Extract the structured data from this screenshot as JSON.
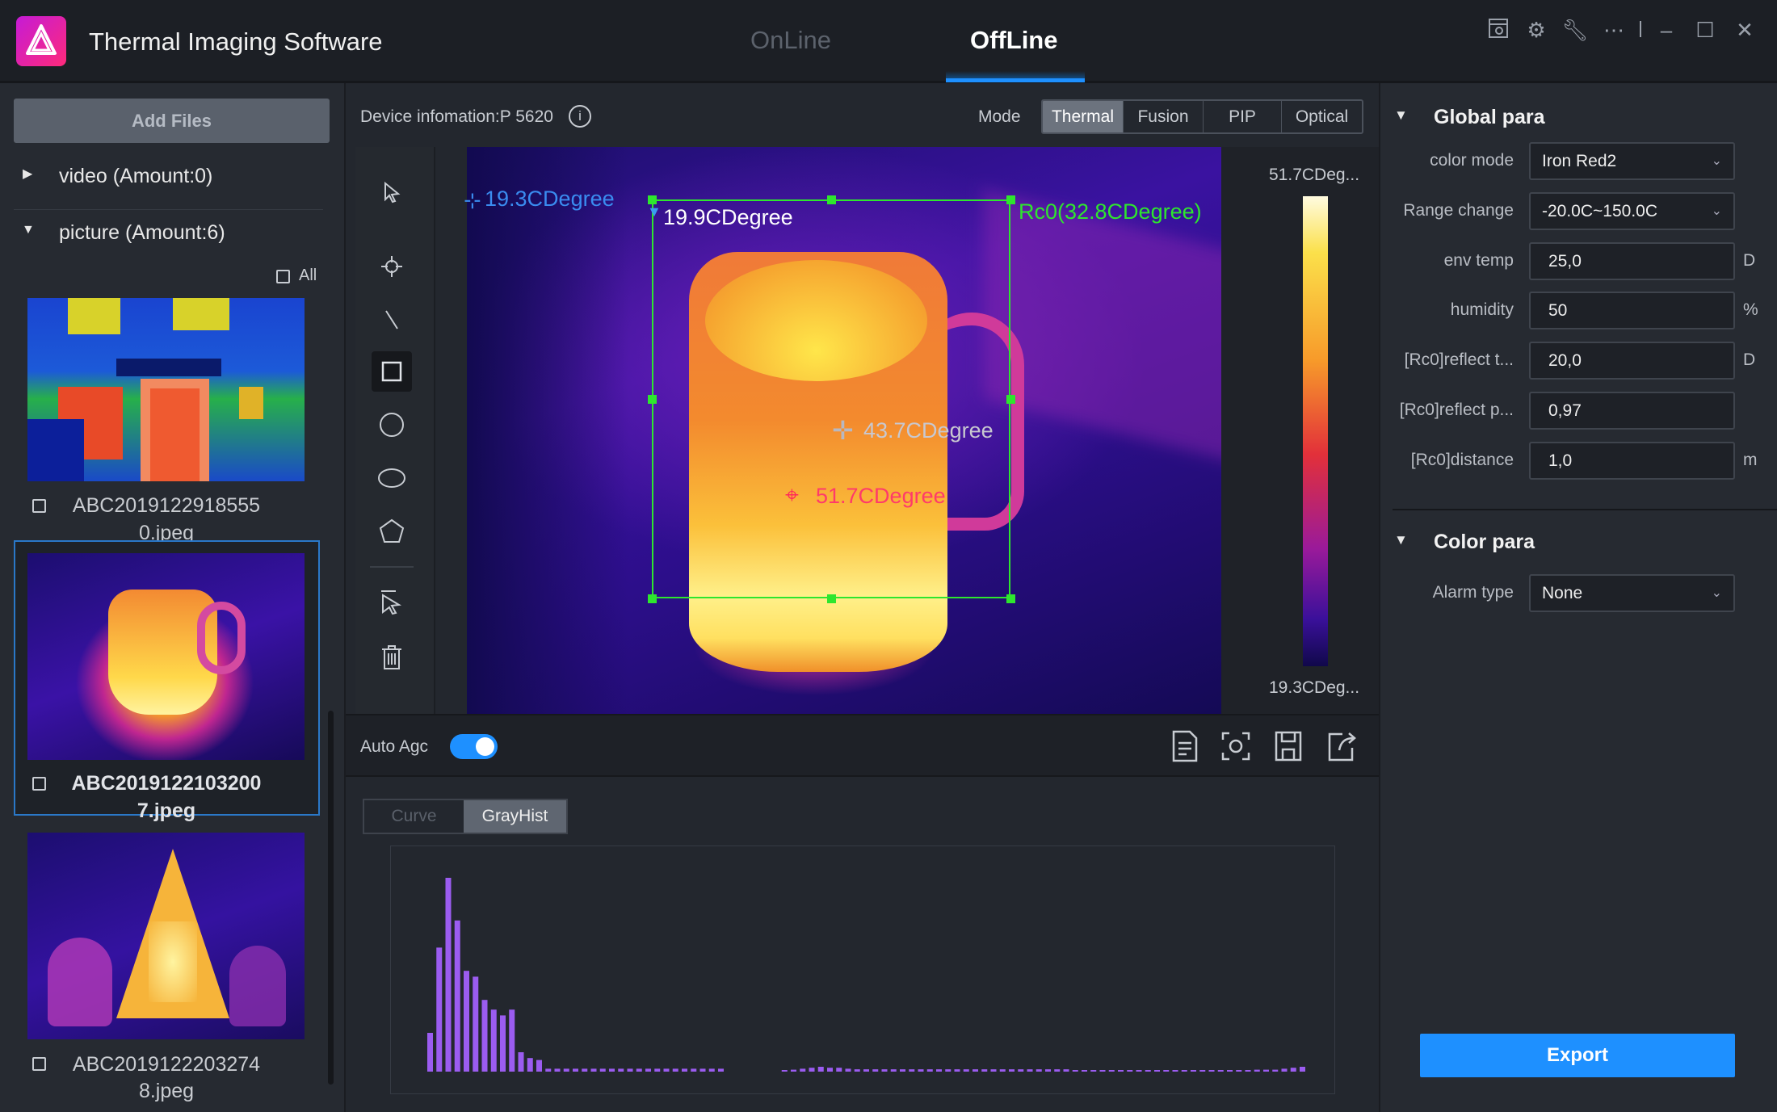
{
  "app": {
    "title": "Thermal Imaging Software",
    "tabs": [
      "OnLine",
      "OffLine"
    ],
    "active_tab": "OffLine",
    "accent": "#1e90ff"
  },
  "window_icons": [
    "camera-icon",
    "gear-icon",
    "wrench-icon",
    "more-icon",
    "separator",
    "minimize-icon",
    "maximize-icon",
    "close-icon"
  ],
  "sidebar": {
    "add_files": "Add Files",
    "groups": [
      {
        "label": "video (Amount:0)",
        "expanded": false
      },
      {
        "label": "picture (Amount:6)",
        "expanded": true
      }
    ],
    "all_label": "All",
    "files": [
      {
        "line1": "ABC2019122918555",
        "line2": "0.jpeg",
        "selected": false
      },
      {
        "line1": "ABC2019122103200",
        "line2": "7.jpeg",
        "selected": true
      },
      {
        "line1": "ABC2019122203274",
        "line2": "8.jpeg",
        "selected": false
      }
    ]
  },
  "viewer": {
    "device_info": "Device infomation:P 5620",
    "mode_label": "Mode",
    "modes": [
      "Thermal",
      "Fusion",
      "PIP",
      "Optical"
    ],
    "active_mode": "Thermal",
    "tools": [
      "pointer-icon",
      "crosshair-icon",
      "line-icon",
      "rectangle-icon",
      "circle-icon",
      "ellipse-icon",
      "polygon-icon",
      "select-icon",
      "trash-icon"
    ],
    "active_tool": "rectangle-icon",
    "annotations": {
      "min_point": "19.3CDegree",
      "roi_min": "19.9CDegree",
      "roi_label": "Rc0(32.8CDegree)",
      "center_point": "43.7CDegree",
      "max_point": "51.7CDegree"
    },
    "scale_max": "51.7CDeg...",
    "scale_min": "19.3CDeg...",
    "auto_agc_label": "Auto Agc",
    "auto_agc_on": true,
    "actions": [
      "report-icon",
      "screenshot-icon",
      "save-icon",
      "export-icon"
    ]
  },
  "histogram": {
    "tabs": [
      "Curve",
      "GrayHist"
    ],
    "active_tab": "GrayHist",
    "bar_color": "#9b5cf0",
    "values": [
      20,
      64,
      100,
      78,
      52,
      49,
      37,
      32,
      29,
      32,
      10,
      7,
      6,
      1.5,
      1.5,
      1.5,
      1.5,
      1.5,
      1.5,
      1.5,
      1.5,
      1.5,
      1.5,
      1.5,
      1.5,
      1.5,
      1.5,
      1.5,
      1.5,
      1.5,
      1.5,
      1.5,
      1.5,
      0,
      0,
      0,
      0,
      0,
      0,
      0.5,
      1,
      1.5,
      2,
      2.5,
      2,
      2,
      1.5,
      1.2,
      1.2,
      1.2,
      1.2,
      1.2,
      1.2,
      1.2,
      1.2,
      1.2,
      1.2,
      1.2,
      1.2,
      1.2,
      1.2,
      1.2,
      1.2,
      1.2,
      1.2,
      1.2,
      1.2,
      1.2,
      1.2,
      1.2,
      1.2,
      0.8,
      0.8,
      0.8,
      0.8,
      0.8,
      0.8,
      0.8,
      0.8,
      0.8,
      0.8,
      0.8,
      0.8,
      0.8,
      0.8,
      0.8,
      0.8,
      0.8,
      0.8,
      0.8,
      0.8,
      1,
      1,
      1,
      1.5,
      2,
      2.5
    ]
  },
  "params": {
    "global_title": "Global para",
    "rows": [
      {
        "label": "color mode",
        "value": "Iron Red2",
        "type": "select",
        "unit": ""
      },
      {
        "label": "Range change",
        "value": "-20.0C~150.0C",
        "type": "select",
        "unit": ""
      },
      {
        "label": "env temp",
        "value": "25,0",
        "type": "input",
        "unit": "D"
      },
      {
        "label": "humidity",
        "value": "50",
        "type": "input",
        "unit": "%"
      },
      {
        "label": "[Rc0]reflect t...",
        "value": "20,0",
        "type": "input",
        "unit": "D"
      },
      {
        "label": "[Rc0]reflect p...",
        "value": "0,97",
        "type": "input",
        "unit": ""
      },
      {
        "label": "[Rc0]distance",
        "value": "1,0",
        "type": "input",
        "unit": "m"
      }
    ],
    "color_title": "Color para",
    "alarm_label": "Alarm type",
    "alarm_value": "None",
    "export": "Export"
  }
}
